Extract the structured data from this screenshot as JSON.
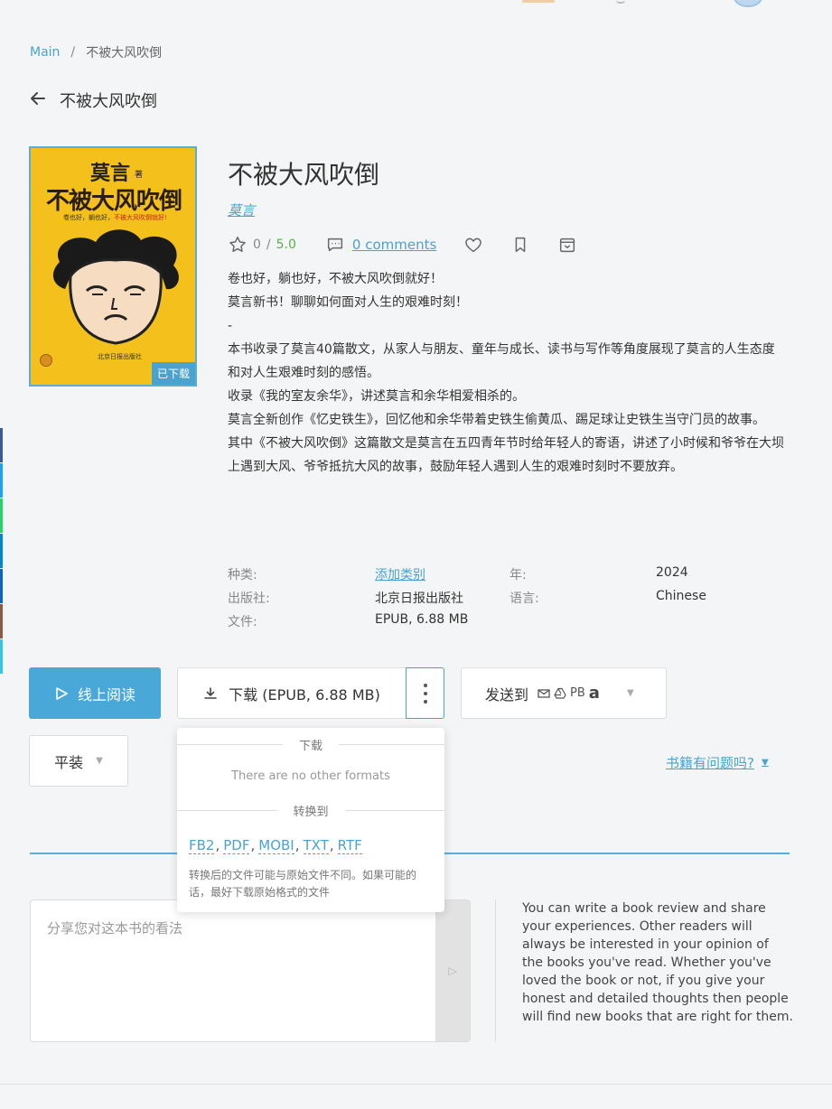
{
  "colors": {
    "accent": "#4aa3cf",
    "rating_max": "#5aaf4d",
    "cover_bg": "#f4c01c"
  },
  "breadcrumb": {
    "home": "Main",
    "separator": "/",
    "current": "不被大风吹倒"
  },
  "back": {
    "title": "不被大风吹倒",
    "icon": "arrow-left-icon"
  },
  "cover": {
    "author": "莫言",
    "author_suffix": "著",
    "title": "不被大风吹倒",
    "tagline_black": "卷也好，躺也好，",
    "tagline_red": "不被大风吹倒就好!",
    "publisher": "北京日报出版社",
    "badge": "已下载"
  },
  "book": {
    "title": "不被大风吹倒",
    "author": "莫言",
    "rating": "0",
    "rating_sep": "/",
    "rating_max": "5.0",
    "comments": "0 comments",
    "description": [
      "卷也好，躺也好，不被大风吹倒就好！",
      "莫言新书！聊聊如何面对人生的艰难时刻！",
      "-",
      "本书收录了莫言40篇散文，从家人与朋友、童年与成长、读书与写作等角度展现了莫言的人生态度和对人生艰难时刻的感悟。",
      "收录《我的室友余华》，讲述莫言和余华相爱相杀的。",
      "莫言全新创作《忆史铁生》，回忆他和余华带着史铁生偷黄瓜、踢足球让史铁生当守门员的故事。",
      "其中《不被大风吹倒》这篇散文是莫言在五四青年节时给年轻人的寄语，讲述了小时候和爷爷在大坝上遇到大风、爷爷抵抗大风的故事，鼓励年轻人遇到人生的艰难时刻时不要放弃。"
    ]
  },
  "details": {
    "category_label": "种类:",
    "category_value": "添加类别",
    "year_label": "年:",
    "year_value": "2024",
    "publisher_label": "出版社:",
    "publisher_value": "北京日报出版社",
    "language_label": "语言:",
    "language_value": "Chinese",
    "file_label": "文件:",
    "file_value": "EPUB, 6.88 MB"
  },
  "actions": {
    "read_online": "线上阅读",
    "download": "下载 (EPUB, 6.88 MB)",
    "send_to": "发送到",
    "send_pb": "PB",
    "send_amazon": "a",
    "binding": "平装",
    "problem": "书籍有问题吗?"
  },
  "dropdown": {
    "download_header": "下载",
    "no_formats": "There are no other formats",
    "convert_header": "转换到",
    "formats": [
      "FB2",
      "PDF",
      "MOBI",
      "TXT",
      "RTF"
    ],
    "note": "转换后的文件可能与原始文件不同。如果可能的话，最好下载原始格式的文件"
  },
  "review": {
    "placeholder": "分享您对这本书的看法",
    "hint": "You can write a book review and share your experiences. Other readers will always be interested in your opinion of the books you've read. Whether you've loved the book or not, if you give your honest and detailed thoughts then people will find new books that are right for them."
  }
}
